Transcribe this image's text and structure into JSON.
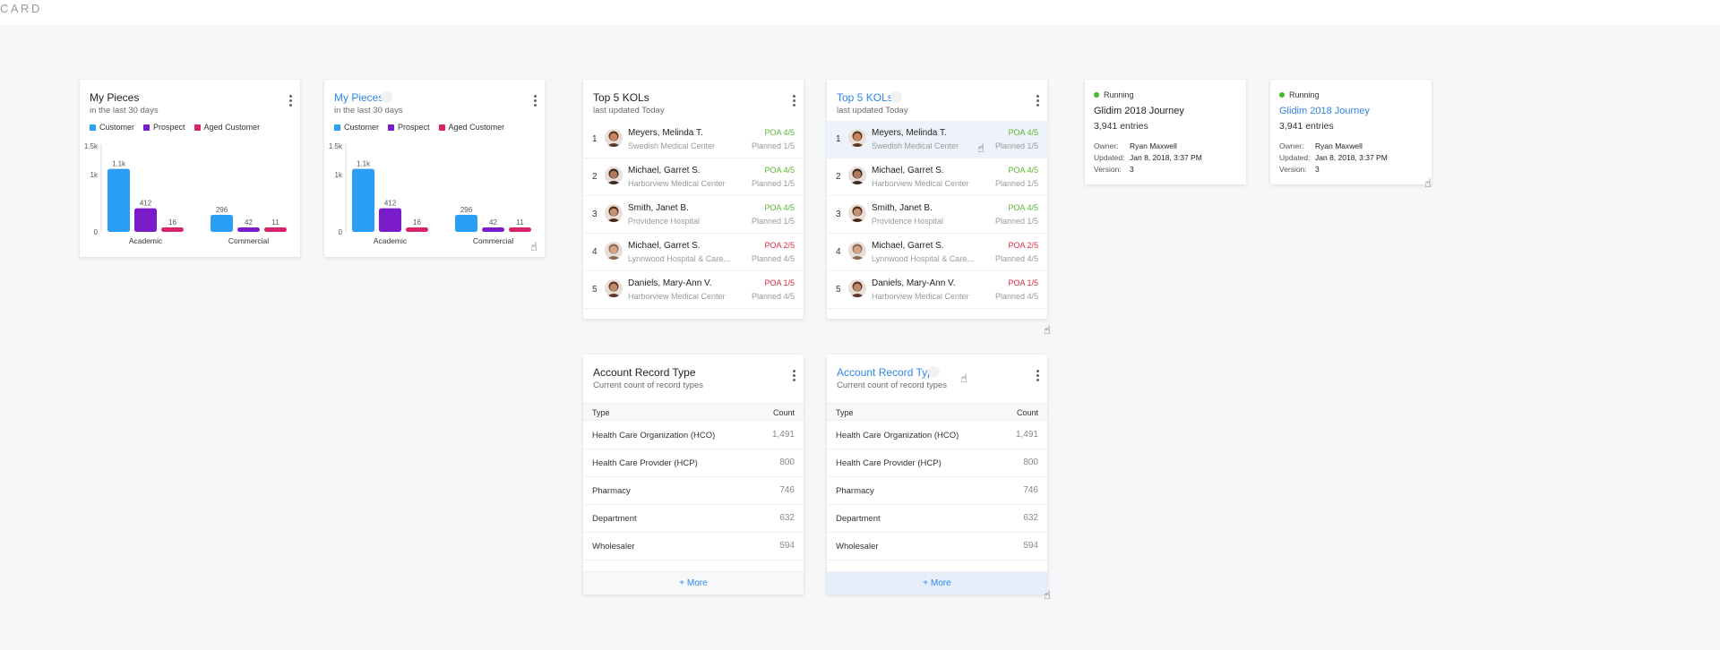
{
  "page": {
    "label": "CARD"
  },
  "colors": {
    "customer": "#2a9df4",
    "prospect": "#7a1cc9",
    "aged": "#d8226a",
    "link": "#2e86e8",
    "green": "#5cb531",
    "red": "#e0283b"
  },
  "pieces": {
    "title": "My Pieces",
    "subtitle": "in the last 30 days",
    "legend": [
      "Customer",
      "Prospect",
      "Aged Customer"
    ],
    "chart_data": {
      "type": "bar",
      "categories": [
        "Academic",
        "Commercial"
      ],
      "series": [
        {
          "name": "Customer",
          "values": [
            1100,
            296
          ],
          "labels": [
            "1.1k",
            "296"
          ]
        },
        {
          "name": "Prospect",
          "values": [
            412,
            42
          ],
          "labels": [
            "412",
            "42"
          ]
        },
        {
          "name": "Aged Customer",
          "values": [
            16,
            11
          ],
          "labels": [
            "16",
            "11"
          ]
        }
      ],
      "yticks": [
        "0",
        "1k",
        "1.5k"
      ],
      "ylim": [
        0,
        1500
      ]
    }
  },
  "kols": {
    "title": "Top 5 KOLs",
    "subtitle": "last updated Today",
    "rows": [
      {
        "rank": "1",
        "name": "Meyers, Melinda T.",
        "org": "Swedish Medical Center",
        "poa": "POA 4/5",
        "status": "green",
        "planned": "Planned 1/5"
      },
      {
        "rank": "2",
        "name": "Michael, Garret S.",
        "org": "Harborview Medical Center",
        "poa": "POA 4/5",
        "status": "green",
        "planned": "Planned 1/5"
      },
      {
        "rank": "3",
        "name": "Smith, Janet B.",
        "org": "Providence Hospital",
        "poa": "POA 4/5",
        "status": "green",
        "planned": "Planned 1/5"
      },
      {
        "rank": "4",
        "name": "Michael, Garret S.",
        "org": "Lynnwood Hospital & Care...",
        "poa": "POA 2/5",
        "status": "red",
        "planned": "Planned 4/5"
      },
      {
        "rank": "5",
        "name": "Daniels, Mary-Ann V.",
        "org": "Harborview Medical Center",
        "poa": "POA 1/5",
        "status": "red",
        "planned": "Planned 4/5"
      }
    ]
  },
  "journey": {
    "status": "Running",
    "title": "Glidim 2018 Journey",
    "entries": "3,941 entries",
    "owner_label": "Owner:",
    "owner": "Ryan Maxwell",
    "updated_label": "Updated:",
    "updated": "Jan 8, 2018, 3:37 PM",
    "version_label": "Version:",
    "version": "3"
  },
  "records": {
    "title": "Account Record Type",
    "subtitle": "Current count of record types",
    "col_type": "Type",
    "col_count": "Count",
    "rows": [
      {
        "type": "Health Care Organization (HCO)",
        "count": "1,491"
      },
      {
        "type": "Health Care Provider (HCP)",
        "count": "800"
      },
      {
        "type": "Pharmacy",
        "count": "746"
      },
      {
        "type": "Department",
        "count": "632"
      },
      {
        "type": "Wholesaler",
        "count": "594"
      }
    ],
    "more": "+ More"
  }
}
